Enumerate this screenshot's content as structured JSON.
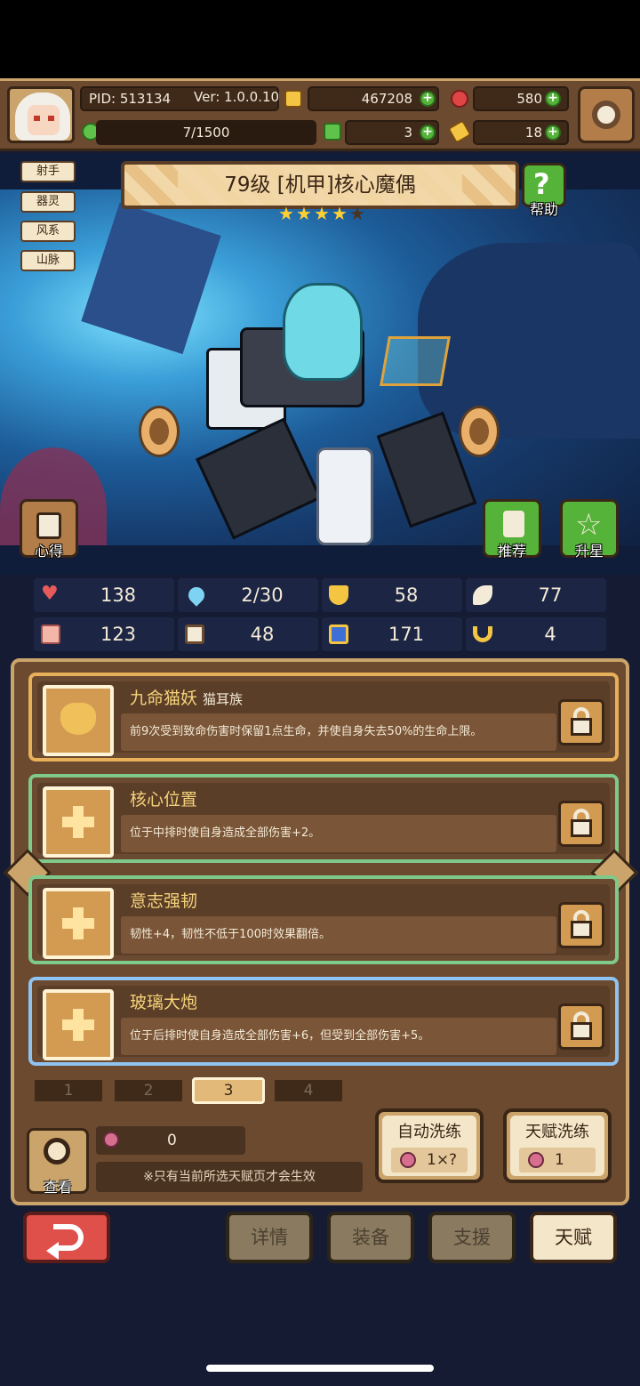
{
  "hud": {
    "pid": "PID: 513134",
    "version": "Ver: 1.0.0.10",
    "exp": "7/1500",
    "gold": "467208",
    "gems": "580",
    "clover": "3",
    "key_count": "18"
  },
  "character": {
    "title": "79级 [机甲]核心魔偶",
    "stars_filled": 4,
    "stars_total": 5,
    "tags": [
      "射手",
      "器灵",
      "风系",
      "山脉"
    ],
    "help_label": "帮助",
    "notes_label": "心得",
    "recommend_label": "推荐",
    "starup_label": "升星"
  },
  "stats": [
    {
      "icon": "heart-icon",
      "value": "138"
    },
    {
      "icon": "water-drop-icon",
      "value": "2/30"
    },
    {
      "icon": "shield-icon",
      "value": "58"
    },
    {
      "icon": "wing-icon",
      "value": "77"
    },
    {
      "icon": "fist-icon",
      "value": "123"
    },
    {
      "icon": "book-icon",
      "value": "48"
    },
    {
      "icon": "scroll-icon",
      "value": "171"
    },
    {
      "icon": "horseshoe-icon",
      "value": "4"
    }
  ],
  "talents": [
    {
      "name": "九命猫妖",
      "subtitle": "猫耳族",
      "desc": "前9次受到致命伤害时保留1点生命，并使自身失去50%的生命上限。"
    },
    {
      "name": "核心位置",
      "subtitle": "",
      "desc": "位于中排时使自身造成全部伤害+2。"
    },
    {
      "name": "意志强韧",
      "subtitle": "",
      "desc": "韧性+4，韧性不低于100时效果翻倍。"
    },
    {
      "name": "玻璃大炮",
      "subtitle": "",
      "desc": "位于后排时使自身造成全部伤害+6，但受到全部伤害+5。"
    }
  ],
  "pages": [
    "1",
    "2",
    "3",
    "4"
  ],
  "active_page": "3",
  "bottom": {
    "view_label": "查看",
    "berry_count": "0",
    "note": "※只有当前所选天赋页才会生效",
    "auto_reroll_label": "自动洗练",
    "auto_reroll_cost": "1×?",
    "talent_reroll_label": "天赋洗练",
    "talent_reroll_cost": "1"
  },
  "nav": {
    "details": "详情",
    "equipment": "装备",
    "support": "支援",
    "talent": "天赋"
  },
  "colors": {
    "panel_brown": "#6b4a2f",
    "gold_border": "#caa46a",
    "talent_name": "#f5d27a",
    "star": "#ffcf33",
    "back_red": "#e0504b"
  }
}
